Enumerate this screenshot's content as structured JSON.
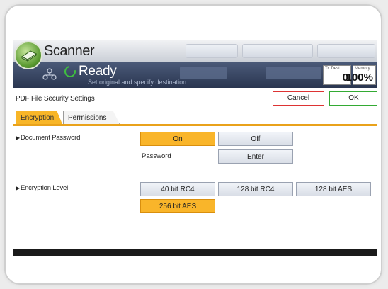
{
  "app": {
    "title": "Scanner"
  },
  "status": {
    "ready": "Ready",
    "message": "Set original and specify destination."
  },
  "counters": [
    {
      "label": "Tr. Dest.",
      "value": "0"
    },
    {
      "label": "Memory",
      "value": "100%"
    }
  ],
  "header": {
    "title": "PDF File Security Settings",
    "cancel_label": "Cancel",
    "ok_label": "OK"
  },
  "tabs": [
    {
      "label": "Encryption",
      "active": true
    },
    {
      "label": "Permissions",
      "active": false
    }
  ],
  "document_password": {
    "label": "Document Password",
    "on_label": "On",
    "off_label": "Off",
    "selected": "On",
    "password_label": "Password",
    "enter_label": "Enter"
  },
  "encryption_level": {
    "label": "Encryption Level",
    "options": [
      "40 bit RC4",
      "128 bit RC4",
      "128 bit AES",
      "256 bit AES"
    ],
    "selected": "256 bit AES"
  },
  "colors": {
    "accent_orange": "#f9b52a",
    "status_bar": "#2a3650",
    "cancel_border": "#dd3333",
    "ok_border": "#33aa33"
  },
  "icons": [
    "scanner-logo-icon",
    "network-icon",
    "ready-icon",
    "arrow-right-icon"
  ]
}
